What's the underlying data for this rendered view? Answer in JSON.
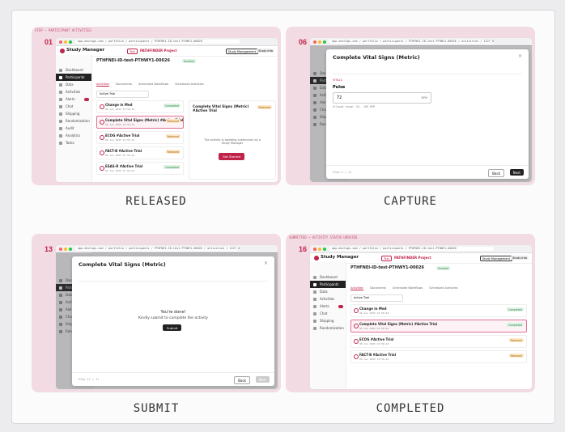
{
  "captions": [
    "RELEASED",
    "CAPTURE",
    "SUBMIT",
    "COMPLETED"
  ],
  "panel1": {
    "strip": "STEP — PARTICIPANT ACTIVITIES",
    "step": "01",
    "url": "app.devlogs.com / portfolio / participants / PTHFNEI-ID-test-PTHWY1-00026",
    "brand": "Study Manager",
    "pill": "Test",
    "project": "PATHFINDER Project",
    "menu1": "Study Management",
    "menu2": "Study Info",
    "title": "PTHFNEI-ID-test-PTHWY1-00026",
    "status": "Enrolled",
    "tabs": [
      "Activities",
      "Documents",
      "Scheduled Workflows",
      "Scheduled Activities"
    ],
    "filter": "Active Trial",
    "activities": [
      {
        "name": "Change in Med",
        "date": "06 Jan 2025 23:56:44",
        "status": "Completed"
      },
      {
        "name": "Complete Vital Signs (Metric) #Active Trial",
        "date": "06 Jan 2025 23:56:44",
        "status": "Released"
      },
      {
        "name": "ECOG #Active Trial",
        "date": "06 Jan 2025 23:56:44",
        "status": "Released"
      },
      {
        "name": "FACT-B #Active Trial",
        "date": "06 Jan 2025 23:56:44",
        "status": "Released"
      },
      {
        "name": "ESAS-R #Active Trial",
        "date": "06 Jan 2025 23:56:44",
        "status": "Completed"
      }
    ],
    "detail_title": "Complete Vital Signs (Metric) #Active Trial",
    "detail_status": "Released",
    "detail_msg": "The activity is awaiting submission by a Study Manager",
    "get_started": "Get Started"
  },
  "panel2": {
    "step": "06",
    "url": "app.devlogs.com / portfolio / participants / PTHFNEI-ID-test-PTHWY1-00026 / activities / 1227_007",
    "modal_title": "Complete Vital Signs (Metric)",
    "section": "VITALS",
    "field_label": "Pulse",
    "field_value": "72",
    "unit": "BPM",
    "hint": "Allowed range: 30 - 180 BPM",
    "step_count": "Step 4 / 11",
    "back": "Back",
    "next": "Next"
  },
  "panel3": {
    "step": "13",
    "url": "app.devlogs.com / portfolio / participants / PTHFNEI-ID-test-PTHWY1-00026 / activities / 1227_007",
    "modal_title": "Complete Vital Signs (Metric)",
    "done1": "You're done!",
    "done2": "Kindly submit to complete the activity",
    "submit": "Submit",
    "step_count": "Step 11 / 11",
    "back": "Back",
    "next": "Next"
  },
  "panel4": {
    "strip": "SUBMITTED → ACTIVITY STATUS UPDATED",
    "step": "16",
    "url": "app.devlogs.com / portfolio / participants / PTHFNEI-ID-test-PTHWY1-00026",
    "title": "PTHFNEI-ID-test-PTHWY1-00026",
    "status": "Enrolled",
    "activities": [
      {
        "name": "Change in Med",
        "date": "06 Jan 2025 23:56:44",
        "status": "Completed"
      },
      {
        "name": "Complete Vital Signs (Metric) #Active Trial",
        "date": "06 Jan 2025 23:56:44",
        "status": "Completed"
      },
      {
        "name": "ECOG #Active Trial",
        "date": "06 Jan 2025 23:56:44",
        "status": "Released"
      },
      {
        "name": "FACT-B #Active Trial",
        "date": "06 Jan 2025 23:56:44",
        "status": "Released"
      }
    ]
  },
  "nav": [
    "Dashboard",
    "Participants",
    "Data",
    "Activities",
    "Alerts",
    "Chat",
    "Shipping",
    "Randomization",
    "Audit",
    "Analytics",
    "Tasks"
  ]
}
